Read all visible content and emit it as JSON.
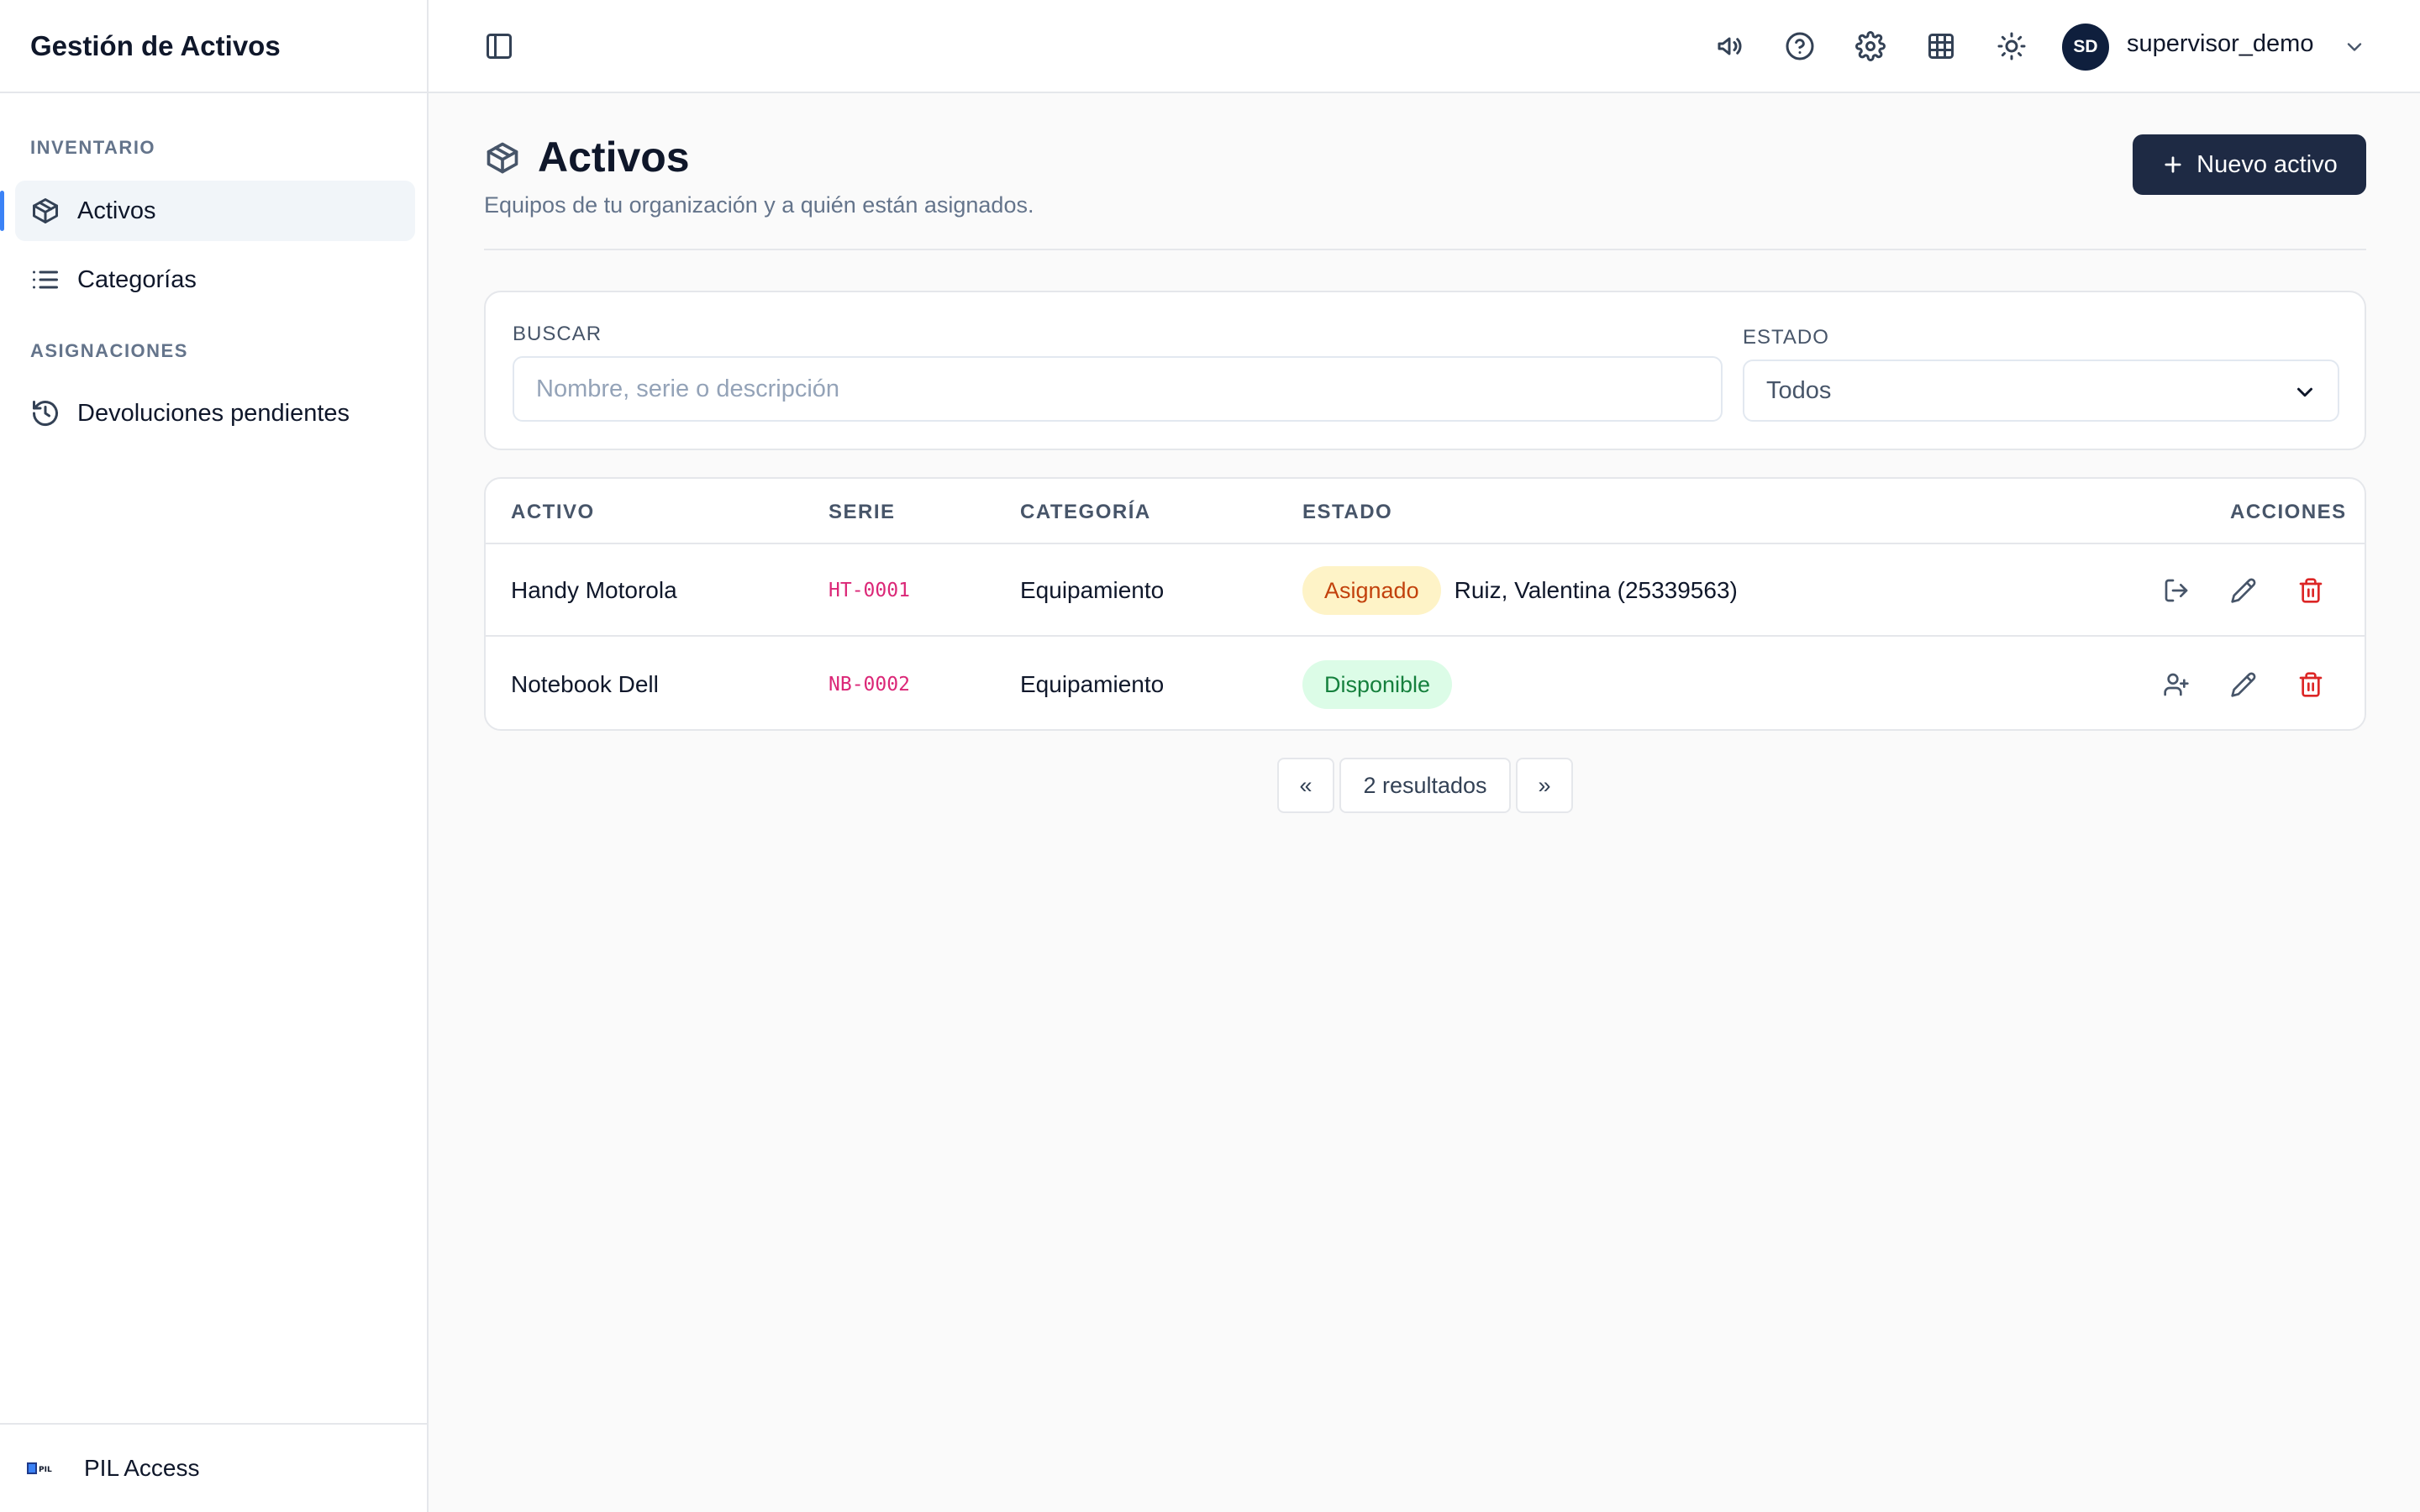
{
  "app": {
    "title": "Gestión de Activos"
  },
  "sidebar": {
    "sections": [
      {
        "label": "INVENTARIO"
      },
      {
        "label": "ASIGNACIONES"
      }
    ],
    "items": [
      {
        "label": "Activos",
        "icon": "box-icon",
        "active": true
      },
      {
        "label": "Categorías",
        "icon": "list-icon"
      },
      {
        "label": "Devoluciones pendientes",
        "icon": "history-icon"
      }
    ],
    "footer": {
      "label": "PIL Access",
      "logo_text": "PIL"
    }
  },
  "header": {
    "icons": [
      "sidebar-toggle-icon",
      "megaphone-icon",
      "help-icon",
      "gear-icon",
      "grid-icon",
      "sun-icon"
    ],
    "user": {
      "initials": "SD",
      "name": "supervisor_demo"
    }
  },
  "page": {
    "title": "Activos",
    "subtitle": "Equipos de tu organización y a quién están asignados.",
    "new_button": "Nuevo activo"
  },
  "filters": {
    "search_label": "BUSCAR",
    "search_placeholder": "Nombre, serie o descripción",
    "search_value": "",
    "estado_label": "ESTADO",
    "estado_value": "Todos"
  },
  "table": {
    "columns": [
      "ACTIVO",
      "SERIE",
      "CATEGORÍA",
      "ESTADO",
      "ACCIONES"
    ],
    "rows": [
      {
        "activo": "Handy Motorola",
        "serie": "HT-0001",
        "categoria": "Equipamiento",
        "estado": "Asignado",
        "asignado_a": "Ruiz, Valentina (25339563)"
      },
      {
        "activo": "Notebook Dell",
        "serie": "NB-0002",
        "categoria": "Equipamiento",
        "estado": "Disponible",
        "asignado_a": ""
      }
    ]
  },
  "pagination": {
    "prev": "«",
    "info": "2 resultados",
    "next": "»"
  },
  "colors": {
    "primary_button": "#1e2a44",
    "asignado_bg": "#fef3c7",
    "asignado_text": "#c2410c",
    "disponible_bg": "#dcfce7",
    "disponible_text": "#15803d",
    "serial_text": "#db2777",
    "delete_icon": "#dc2626"
  }
}
